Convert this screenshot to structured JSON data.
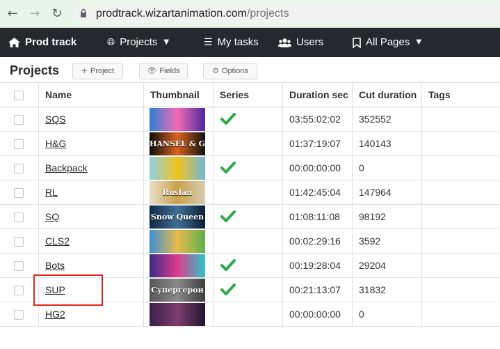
{
  "browser": {
    "url_host": "prodtrack.wizartanimation.com",
    "url_path": "/projects",
    "back_icon": "arrow-left",
    "forward_icon": "arrow-right",
    "reload_icon": "reload"
  },
  "nav": {
    "brand": "Prod track",
    "projects": "Projects",
    "my_tasks": "My tasks",
    "users": "Users",
    "all_pages": "All Pages"
  },
  "toolbar": {
    "title": "Projects",
    "add_project": "Project",
    "fields": "Fields",
    "options": "Options"
  },
  "table": {
    "headers": {
      "name": "Name",
      "thumbnail": "Thumbnail",
      "series": "Series",
      "duration": "Duration sec",
      "cut_duration": "Cut duration",
      "tags": "Tags"
    },
    "rows": [
      {
        "name": "SQS",
        "series": true,
        "duration": "03:55:02:02",
        "cut": "352552",
        "thumb_text": "",
        "thumb_colors": [
          "#2d7fd6",
          "#f26ab2",
          "#4a2aa0"
        ]
      },
      {
        "name": "H&G",
        "series": false,
        "duration": "01:37:19:07",
        "cut": "140143",
        "thumb_text": "HANSEL & GRETEL",
        "thumb_colors": [
          "#0d0d0d",
          "#d9631f",
          "#111111"
        ]
      },
      {
        "name": "Backpack",
        "series": true,
        "duration": "00:00:00:00",
        "cut": "0",
        "thumb_text": "",
        "thumb_colors": [
          "#8fd0e6",
          "#f2c41c",
          "#6fb8d8"
        ]
      },
      {
        "name": "RL",
        "series": false,
        "duration": "01:42:45:04",
        "cut": "147964",
        "thumb_text": "Ruslan",
        "thumb_colors": [
          "#e9dfc8",
          "#caa24c",
          "#d7ccb0"
        ]
      },
      {
        "name": "SQ",
        "series": true,
        "duration": "01:08:11:08",
        "cut": "98192",
        "thumb_text": "Snow Queen",
        "thumb_colors": [
          "#0f2b45",
          "#3f6f95",
          "#0b1f33"
        ]
      },
      {
        "name": "CLS2",
        "series": false,
        "duration": "00:02:29:16",
        "cut": "3592",
        "thumb_text": "",
        "thumb_colors": [
          "#3c8fd8",
          "#e9b94a",
          "#5fb04e"
        ]
      },
      {
        "name": "Bots",
        "series": true,
        "duration": "00:19:28:04",
        "cut": "29204",
        "thumb_text": "",
        "thumb_colors": [
          "#3a2a88",
          "#e03a8e",
          "#2bc4c7"
        ]
      },
      {
        "name": "SUP",
        "series": true,
        "duration": "00:21:13:07",
        "cut": "31832",
        "thumb_text": "Супергерои",
        "thumb_colors": [
          "#585858",
          "#8a8a8a",
          "#3e3e3e"
        ]
      },
      {
        "name": "HG2",
        "series": false,
        "duration": "00:00:00:00",
        "cut": "0",
        "thumb_text": "",
        "thumb_colors": [
          "#3b1f4a",
          "#7d3d6e",
          "#24142e"
        ]
      }
    ]
  },
  "colors": {
    "nav_bg": "#25292e",
    "check_green": "#2aa84a",
    "highlight_red": "#e02424"
  }
}
